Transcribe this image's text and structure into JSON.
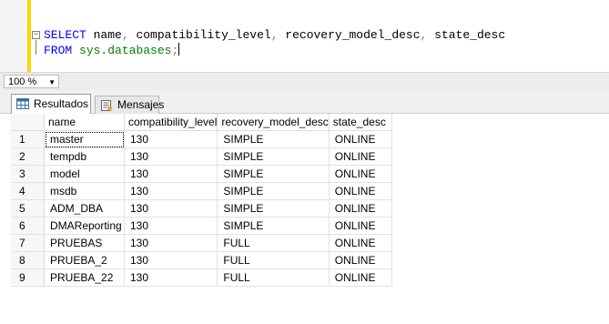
{
  "editor": {
    "line1": {
      "select_kw": "SELECT",
      "columns": "name, compatibility_level, recovery_model_desc, state_desc"
    },
    "line2": {
      "from_kw": "FROM",
      "table": "sys.databases",
      "terminator": ";"
    },
    "collapse_glyph": "−"
  },
  "zoom": {
    "value": "100 %"
  },
  "tabs": [
    {
      "label": "Resultados",
      "icon": "grid-icon",
      "active": true
    },
    {
      "label": "Mensajes",
      "icon": "messages-icon",
      "active": false
    }
  ],
  "results": {
    "columns": [
      "name",
      "compatibility_level",
      "recovery_model_desc",
      "state_desc"
    ],
    "rows": [
      {
        "num": "1",
        "name": "master",
        "compatibility_level": "130",
        "recovery_model_desc": "SIMPLE",
        "state_desc": "ONLINE"
      },
      {
        "num": "2",
        "name": "tempdb",
        "compatibility_level": "130",
        "recovery_model_desc": "SIMPLE",
        "state_desc": "ONLINE"
      },
      {
        "num": "3",
        "name": "model",
        "compatibility_level": "130",
        "recovery_model_desc": "SIMPLE",
        "state_desc": "ONLINE"
      },
      {
        "num": "4",
        "name": "msdb",
        "compatibility_level": "130",
        "recovery_model_desc": "SIMPLE",
        "state_desc": "ONLINE"
      },
      {
        "num": "5",
        "name": "ADM_DBA",
        "compatibility_level": "130",
        "recovery_model_desc": "SIMPLE",
        "state_desc": "ONLINE"
      },
      {
        "num": "6",
        "name": "DMAReporting",
        "compatibility_level": "130",
        "recovery_model_desc": "SIMPLE",
        "state_desc": "ONLINE"
      },
      {
        "num": "7",
        "name": "PRUEBAS",
        "compatibility_level": "130",
        "recovery_model_desc": "FULL",
        "state_desc": "ONLINE"
      },
      {
        "num": "8",
        "name": "PRUEBA_2",
        "compatibility_level": "130",
        "recovery_model_desc": "FULL",
        "state_desc": "ONLINE"
      },
      {
        "num": "9",
        "name": "PRUEBA_22",
        "compatibility_level": "130",
        "recovery_model_desc": "FULL",
        "state_desc": "ONLINE"
      }
    ]
  },
  "colors": {
    "keyword": "#0000ff",
    "function": "#ff00ff",
    "system_object": "#008000",
    "change_bar": "#ffd300"
  }
}
